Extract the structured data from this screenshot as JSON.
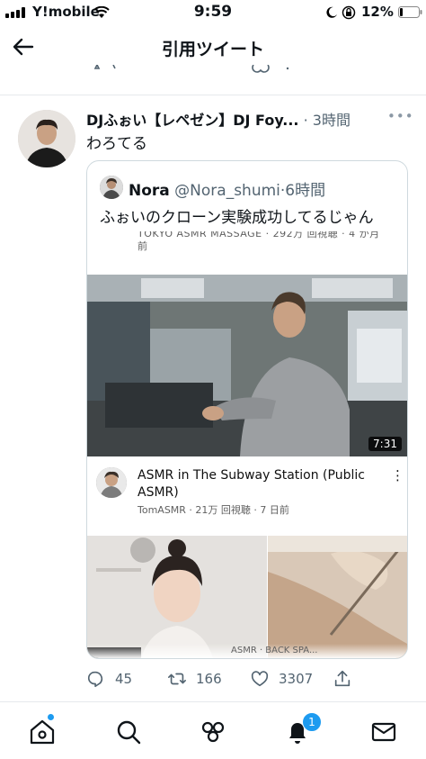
{
  "status_bar": {
    "carrier": "Y!mobile",
    "time": "9:59",
    "battery": "12%"
  },
  "header": {
    "title": "引用ツイート"
  },
  "tweet": {
    "author_name": "DJふぉい【レペゼン】DJ Foy...",
    "time": "3時間",
    "text": "わろてる",
    "quote": {
      "author_name": "Nora",
      "handle": "@Nora_shumi",
      "time": "6時間",
      "text": "ふぉいのクローン実験成功してるじゃん",
      "cut_top_meta": "TOKYO ASMR MASSAGE · 292万 回視聴 · 4 か月",
      "cut_top_meta_2": "前",
      "video": {
        "duration": "7:31",
        "title": "ASMR in The Subway Station (Public ASMR)",
        "channel_meta": "TomASMR · 21万 回視聴 · 7 日前"
      },
      "cut_bottom_text": "ASMR · BACK SPA..."
    },
    "actions": {
      "replies": "45",
      "retweets": "166",
      "likes": "3307"
    }
  },
  "tab_bar": {
    "items": [
      "home-icon",
      "search-icon",
      "communities-icon",
      "notifications-icon",
      "messages-icon"
    ],
    "notifications_badge": "1"
  },
  "colors": {
    "accent": "#1d9bf0",
    "secondary_text": "#536471",
    "border": "#cfd9de"
  }
}
